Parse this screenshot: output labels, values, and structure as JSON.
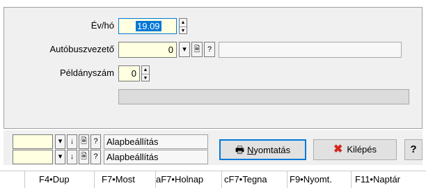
{
  "form": {
    "year_month": {
      "label": "Év/hó",
      "value": "19.09"
    },
    "driver": {
      "label": "Autóbuszvezető",
      "value": "0",
      "lookup_label": "?",
      "name_value": ""
    },
    "copies": {
      "label": "Példányszám",
      "value": "0"
    }
  },
  "settings_rows": [
    {
      "value": "",
      "lookup_label": "?",
      "name": "Alapbeállítás"
    },
    {
      "value": "",
      "lookup_label": "?",
      "name": "Alapbeállítás"
    }
  ],
  "buttons": {
    "print": {
      "label_prefix": "",
      "label_underlined": "N",
      "label_rest": "yomtatás",
      "icon": "printer-icon"
    },
    "exit": {
      "label": "Kilépés",
      "icon": "close-x-icon",
      "icon_color": "#d4281c"
    },
    "help": {
      "label": "?"
    }
  },
  "fkeys": [
    "F4•Dup",
    "F7•Most",
    "aF7•Holnap",
    "cF7•Tegna",
    "F9•Nyomt.",
    "F11•Naptár"
  ],
  "colors": {
    "field_bg": "#ffffe1",
    "selection": "#0078d7",
    "panel_bg": "#f0f0f0"
  }
}
